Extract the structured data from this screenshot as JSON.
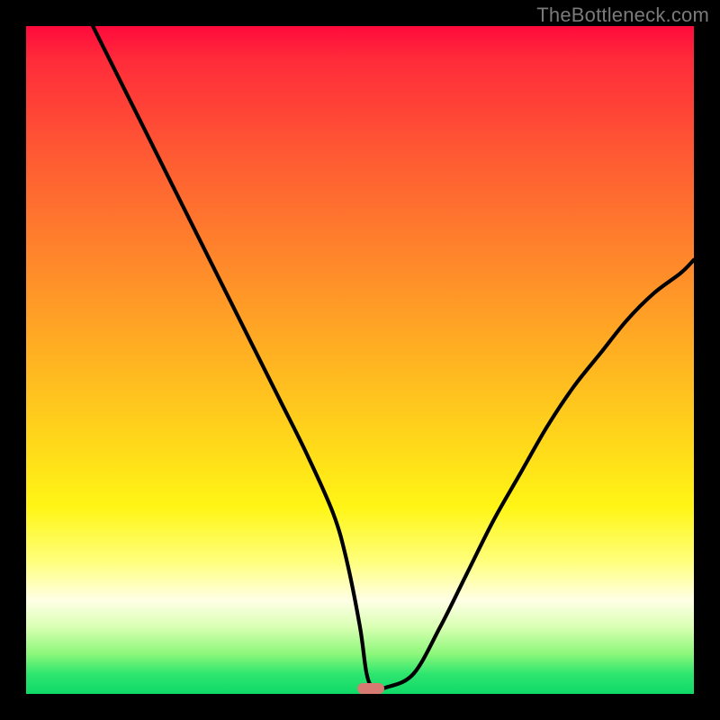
{
  "watermark": {
    "text": "TheBottleneck.com"
  },
  "chart_data": {
    "type": "line",
    "title": "",
    "xlabel": "",
    "ylabel": "",
    "xlim": [
      0,
      100
    ],
    "ylim": [
      0,
      100
    ],
    "grid": false,
    "background": "rainbow-vertical-gradient",
    "series": [
      {
        "name": "bottleneck-curve",
        "stroke": "#000000",
        "x": [
          10,
          14,
          18,
          22,
          26,
          30,
          34,
          38,
          42,
          46,
          48,
          50,
          51,
          52,
          54,
          58,
          62,
          66,
          70,
          74,
          78,
          82,
          86,
          90,
          94,
          98,
          100
        ],
        "y": [
          100,
          92,
          84,
          76,
          68,
          60,
          52,
          44,
          36,
          27,
          20,
          10,
          3,
          1,
          1,
          3,
          10,
          18,
          26,
          33,
          40,
          46,
          51,
          56,
          60,
          63,
          65
        ]
      }
    ],
    "marker": {
      "name": "optimal-zone",
      "color": "#d77a72",
      "x_center": 51.6,
      "width_pct": 4.0,
      "y_pct": 0.8
    }
  }
}
